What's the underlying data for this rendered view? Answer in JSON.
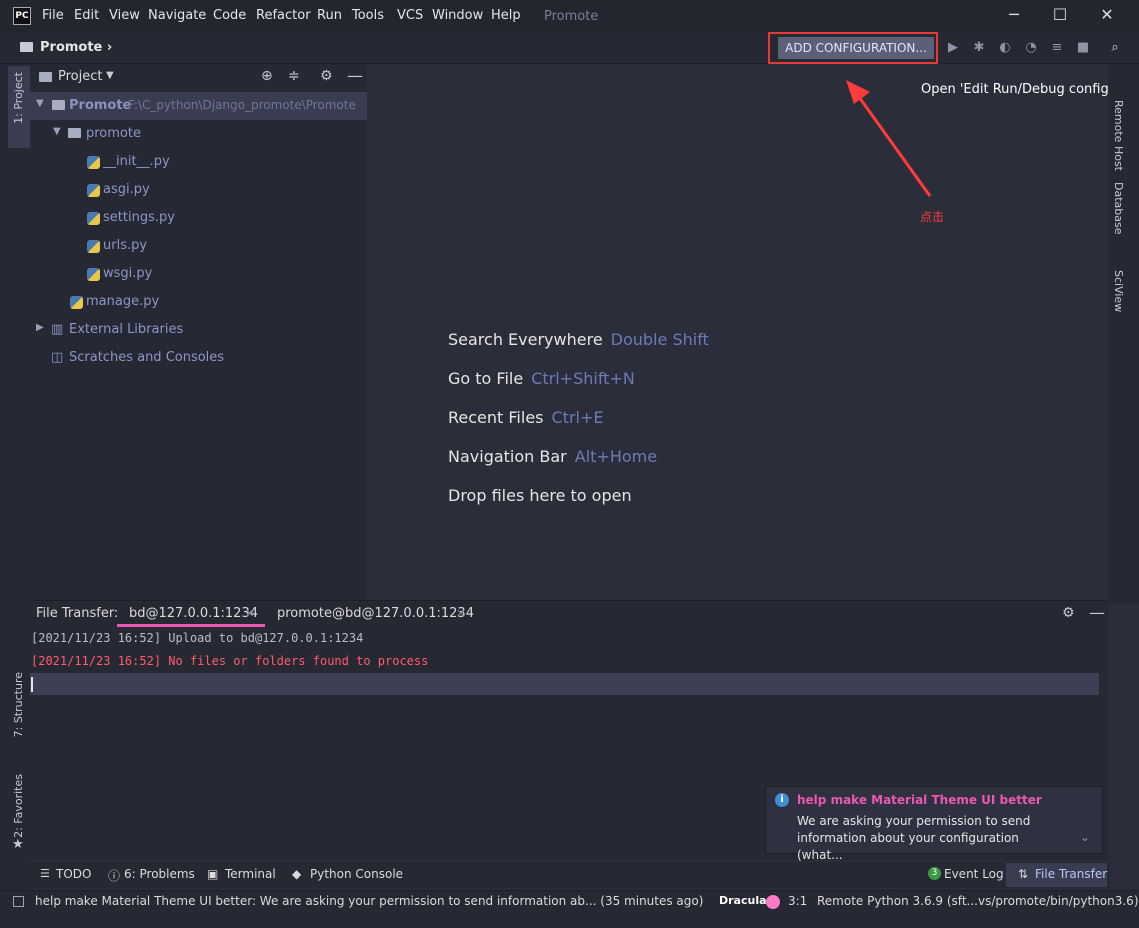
{
  "window": {
    "logo": "PC",
    "menu": [
      "File",
      "Edit",
      "View",
      "Navigate",
      "Code",
      "Refactor",
      "Run",
      "Tools",
      "VCS",
      "Window",
      "Help"
    ],
    "title": "Promote",
    "controls": [
      "─",
      "☐",
      "✕"
    ]
  },
  "navbar": {
    "breadcrumb": "Promote ›",
    "add_config": "ADD CONFIGURATION...",
    "tooltip": "Open 'Edit Run/Debug configurations'",
    "annotation": "点击"
  },
  "left_strip": {
    "project_tab": "1: Project",
    "structure_tab": "7: Structure",
    "favorites_tab": "2: Favorites"
  },
  "right_strip": {
    "tabs": [
      "Remote Host",
      "Database",
      "SciView"
    ]
  },
  "project": {
    "title": "Project",
    "root_name": "Promote",
    "root_path": "F:\\C_python\\Django_promote\\Promote",
    "folder": "promote",
    "files": [
      "__init__.py",
      "asgi.py",
      "settings.py",
      "urls.py",
      "wsgi.py"
    ],
    "manage": "manage.py",
    "ext_libs": "External Libraries",
    "scratches": "Scratches and Consoles"
  },
  "editor_hints": [
    {
      "label": "Search Everywhere",
      "key": "Double Shift"
    },
    {
      "label": "Go to File",
      "key": "Ctrl+Shift+N"
    },
    {
      "label": "Recent Files",
      "key": "Ctrl+E"
    },
    {
      "label": "Navigation Bar",
      "key": "Alt+Home"
    },
    {
      "label": "Drop files here to open",
      "key": ""
    }
  ],
  "file_transfer": {
    "label": "File Transfer:",
    "tabs": [
      "bd@127.0.0.1:1234",
      "promote@bd@127.0.0.1:1234"
    ],
    "log": [
      {
        "text": "[2021/11/23 16:52] Upload to bd@127.0.0.1:1234",
        "color": "#b9bdd0"
      },
      {
        "text": "[2021/11/23 16:52] No files or folders found to process",
        "color": "#ff5c6c"
      }
    ]
  },
  "notification": {
    "title": "help make Material Theme UI better",
    "body": "We are asking your permission to send information about your configuration (what..."
  },
  "tool_tabs": [
    "TODO",
    "6: Problems",
    "Terminal",
    "Python Console",
    "Event Log",
    "File Transfer"
  ],
  "event_log_count": "3",
  "status": {
    "message": "help make Material Theme UI better: We are asking your permission to send information ab... (35 minutes ago)",
    "theme": "Dracula",
    "position": "3:1",
    "interpreter": "Remote Python 3.6.9 (sft...vs/promote/bin/python3.6)"
  }
}
